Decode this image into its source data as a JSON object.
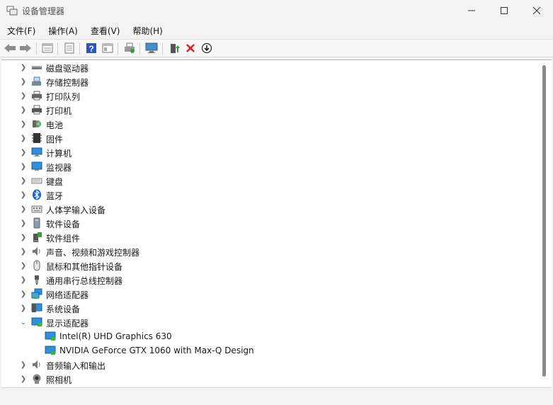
{
  "window": {
    "title": "设备管理器"
  },
  "menu": [
    {
      "label": "文件(F)"
    },
    {
      "label": "操作(A)"
    },
    {
      "label": "查看(V)"
    },
    {
      "label": "帮助(H)"
    }
  ],
  "toolbar": {
    "buttons": [
      {
        "icon": "back-arrow-icon"
      },
      {
        "icon": "forward-arrow-icon"
      },
      {
        "icon": "properties-icon"
      },
      {
        "icon": "driver-details-icon"
      },
      {
        "icon": "help-icon"
      },
      {
        "icon": "view-icon"
      },
      {
        "icon": "print-icon"
      },
      {
        "icon": "scan-hardware-icon"
      },
      {
        "icon": "update-driver-icon"
      },
      {
        "icon": "uninstall-icon"
      },
      {
        "icon": "disable-icon"
      }
    ]
  },
  "tree": {
    "items": [
      {
        "label": "磁盘驱动器",
        "icon": "disk-drive-icon",
        "expanded": false
      },
      {
        "label": "存储控制器",
        "icon": "storage-controller-icon",
        "expanded": false
      },
      {
        "label": "打印队列",
        "icon": "print-queue-icon",
        "expanded": false
      },
      {
        "label": "打印机",
        "icon": "printer-icon",
        "expanded": false
      },
      {
        "label": "电池",
        "icon": "battery-icon",
        "expanded": false
      },
      {
        "label": "固件",
        "icon": "firmware-icon",
        "expanded": false
      },
      {
        "label": "计算机",
        "icon": "computer-icon",
        "expanded": false
      },
      {
        "label": "监视器",
        "icon": "monitor-icon",
        "expanded": false
      },
      {
        "label": "键盘",
        "icon": "keyboard-icon",
        "expanded": false
      },
      {
        "label": "蓝牙",
        "icon": "bluetooth-icon",
        "expanded": false
      },
      {
        "label": "人体学输入设备",
        "icon": "hid-icon",
        "expanded": false
      },
      {
        "label": "软件设备",
        "icon": "software-device-icon",
        "expanded": false
      },
      {
        "label": "软件组件",
        "icon": "software-component-icon",
        "expanded": false
      },
      {
        "label": "声音、视频和游戏控制器",
        "icon": "sound-icon",
        "expanded": false
      },
      {
        "label": "鼠标和其他指针设备",
        "icon": "mouse-icon",
        "expanded": false
      },
      {
        "label": "通用串行总线控制器",
        "icon": "usb-icon",
        "expanded": false
      },
      {
        "label": "网络适配器",
        "icon": "network-adapter-icon",
        "expanded": false
      },
      {
        "label": "系统设备",
        "icon": "system-device-icon",
        "expanded": false
      },
      {
        "label": "显示适配器",
        "icon": "display-adapter-icon",
        "expanded": true
      },
      {
        "label": "Intel(R) UHD Graphics 630",
        "icon": "display-adapter-icon",
        "child": true
      },
      {
        "label": "NVIDIA GeForce GTX 1060 with Max-Q Design",
        "icon": "display-adapter-icon",
        "child": true
      },
      {
        "label": "音频输入和输出",
        "icon": "audio-io-icon",
        "expanded": false
      },
      {
        "label": "照相机",
        "icon": "camera-icon",
        "expanded": false
      }
    ]
  }
}
